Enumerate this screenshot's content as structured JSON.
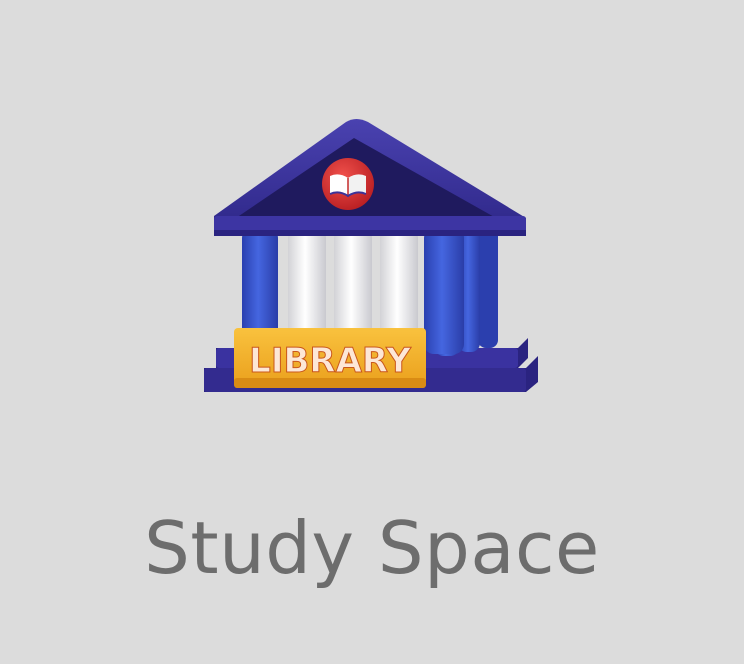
{
  "app_tile": {
    "sign_text": "LIBRARY",
    "label": "Study Space",
    "icon": "library-building-icon",
    "emblem_icon": "open-book-icon"
  },
  "colors": {
    "background": "#dcdcdc",
    "roof": "#3c3397",
    "base": "#2f2885",
    "column_blue": "#3552c9",
    "column_white": "#f0f0f0",
    "sign": "#f5b52c",
    "sign_text": "#fde7d6",
    "emblem": "#e2302f",
    "label": "#6d6d6d"
  }
}
